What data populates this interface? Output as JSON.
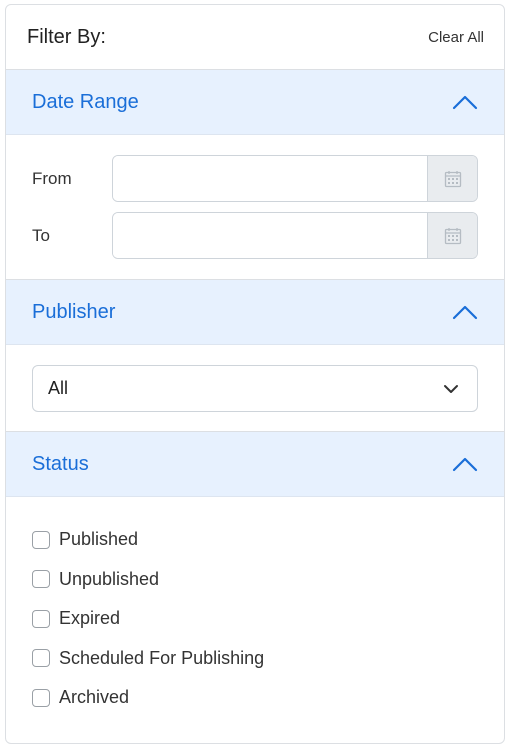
{
  "header": {
    "title": "Filter By:",
    "clear_label": "Clear All"
  },
  "sections": {
    "date_range": {
      "title": "Date Range",
      "from_label": "From",
      "to_label": "To",
      "from_value": "",
      "to_value": ""
    },
    "publisher": {
      "title": "Publisher",
      "selected": "All"
    },
    "status": {
      "title": "Status",
      "options": [
        "Published",
        "Unpublished",
        "Expired",
        "Scheduled For Publishing",
        "Archived"
      ]
    }
  },
  "colors": {
    "accent": "#1a6ed8",
    "section_header_bg": "#e7f1fe",
    "border": "#dcdfe3"
  },
  "icons": {
    "collapse": "chevron-up-icon",
    "calendar": "calendar-icon",
    "dropdown": "chevron-down-icon"
  }
}
